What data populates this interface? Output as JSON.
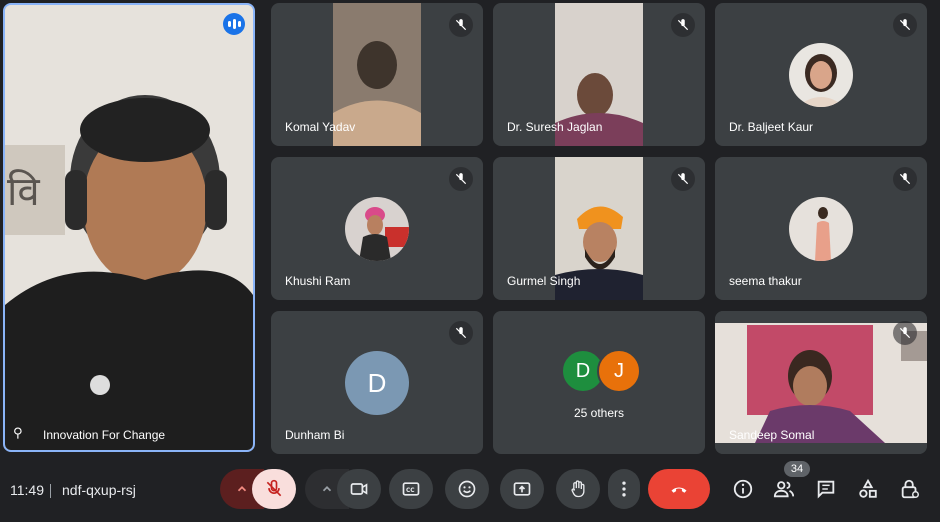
{
  "meeting": {
    "time": "11:49",
    "code": "ndf-qxup-rsj",
    "participant_count": "34"
  },
  "tiles": {
    "speaker": {
      "name": "Innovation For Change"
    },
    "komal": {
      "name": "Komal Yadav"
    },
    "suresh": {
      "name": "Dr. Suresh Jaglan"
    },
    "baljeet": {
      "name": "Dr. Baljeet Kaur"
    },
    "khushi": {
      "name": "Khushi Ram"
    },
    "gurmel": {
      "name": "Gurmel Singh"
    },
    "seema": {
      "name": "seema thakur"
    },
    "dunham": {
      "name": "Dunham Bi",
      "initial": "D"
    },
    "others": {
      "label": "25 others",
      "initial_1": "D",
      "initial_2": "J"
    },
    "sandeep": {
      "name": "Sandeep Somal"
    }
  },
  "colors": {
    "accent_blue": "#8ab4f8",
    "end_call_red": "#ea4335",
    "mic_off_bg": "#f9dedc",
    "avatar_d_green": "#1e8e3e",
    "avatar_j_orange": "#e8710a",
    "avatar_dunham": "#7b98b3"
  }
}
